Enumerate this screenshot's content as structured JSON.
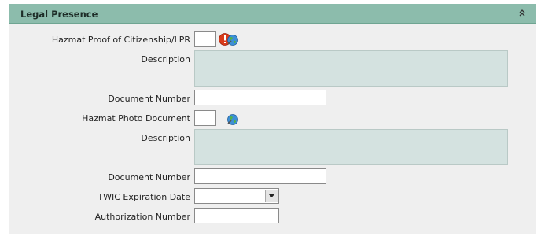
{
  "panel": {
    "title": "Legal Presence",
    "collapse_icon": "double-chevron-up-icon"
  },
  "fields": {
    "hazmat_proof": {
      "label": "Hazmat Proof of Citizenship/LPR",
      "value": ""
    },
    "description_1": {
      "label": "Description",
      "value": ""
    },
    "document_number_1": {
      "label": "Document Number",
      "value": ""
    },
    "hazmat_photo": {
      "label": "Hazmat Photo Document",
      "value": ""
    },
    "description_2": {
      "label": "Description",
      "value": ""
    },
    "document_number_2": {
      "label": "Document Number",
      "value": ""
    },
    "twic_expiration": {
      "label": "TWIC Expiration Date",
      "value": ""
    },
    "authorization_number": {
      "label": "Authorization Number",
      "value": ""
    }
  },
  "icons": {
    "error": "error-exclamation-icon",
    "lookup": "globe-lookup-icon"
  },
  "colors": {
    "header_bg": "#8cbcac",
    "panel_bg": "#efefef",
    "description_bg": "#d4e2e0",
    "error_red": "#d93a1a"
  }
}
